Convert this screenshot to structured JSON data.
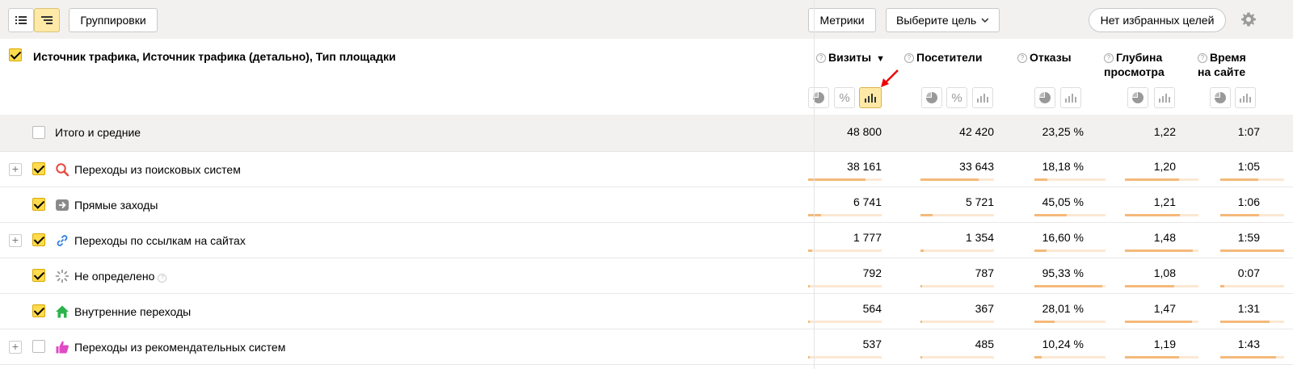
{
  "toolbar": {
    "groupings_label": "Группировки",
    "metrics_label": "Метрики",
    "goal_label": "Выберите цель",
    "favorites_label": "Нет избранных целей"
  },
  "header": {
    "dimension_title": "Источник трафика, Источник трафика (детально), Тип площадки",
    "columns": [
      {
        "label": "Визиты",
        "label2": ""
      },
      {
        "label": "Посетители",
        "label2": ""
      },
      {
        "label": "Отказы",
        "label2": ""
      },
      {
        "label": "Глубина",
        "label2": "просмотра"
      },
      {
        "label": "Время",
        "label2": "на сайте"
      }
    ],
    "sort_indicator": "▼"
  },
  "total": {
    "label": "Итого и средние",
    "values": [
      "48 800",
      "42 420",
      "23,25 %",
      "1,22",
      "1:07"
    ]
  },
  "rows": [
    {
      "label": "Переходы из поисковых систем",
      "icon": "search-icon",
      "checked": true,
      "expandable": true,
      "values": [
        "38 161",
        "33 643",
        "18,18 %",
        "1,20",
        "1:05"
      ],
      "bars": [
        0.78,
        0.79,
        0.18,
        0.74,
        0.6
      ]
    },
    {
      "label": "Прямые заходы",
      "icon": "arrow-right-icon",
      "checked": true,
      "expandable": false,
      "values": [
        "6 741",
        "5 721",
        "45,05 %",
        "1,21",
        "1:06"
      ],
      "bars": [
        0.18,
        0.17,
        0.45,
        0.75,
        0.61
      ]
    },
    {
      "label": "Переходы по ссылкам на сайтах",
      "icon": "link-icon",
      "checked": true,
      "expandable": true,
      "values": [
        "1 777",
        "1 354",
        "16,60 %",
        "1,48",
        "1:59"
      ],
      "bars": [
        0.05,
        0.04,
        0.17,
        0.92,
        1.0
      ]
    },
    {
      "label": "Не определено",
      "icon": "spinner-icon",
      "checked": true,
      "expandable": false,
      "has_hint": true,
      "values": [
        "792",
        "787",
        "95,33 %",
        "1,08",
        "0:07"
      ],
      "bars": [
        0.02,
        0.02,
        0.95,
        0.67,
        0.06
      ]
    },
    {
      "label": "Внутренние переходы",
      "icon": "home-icon",
      "checked": true,
      "expandable": false,
      "values": [
        "564",
        "367",
        "28,01 %",
        "1,47",
        "1:31"
      ],
      "bars": [
        0.015,
        0.012,
        0.28,
        0.91,
        0.77
      ]
    },
    {
      "label": "Переходы из рекомендательных систем",
      "icon": "thumbs-up-icon",
      "checked": false,
      "expandable": true,
      "values": [
        "537",
        "485",
        "10,24 %",
        "1,19",
        "1:43"
      ],
      "bars": [
        0.014,
        0.014,
        0.1,
        0.74,
        0.87
      ]
    }
  ],
  "colors": {
    "accent": "#ffdb4d",
    "bar": "#f5b97a",
    "bar_bg": "#fbe8d3",
    "toolbar_bg": "#f2f1ef"
  }
}
